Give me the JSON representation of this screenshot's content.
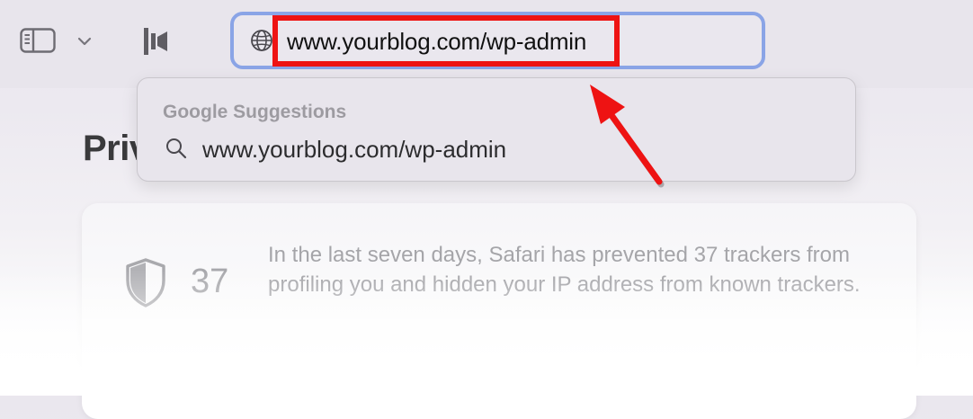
{
  "toolbar": {
    "sidebar_icon": "sidebar-icon",
    "chevron_icon": "chevron-down-icon",
    "extension_icon": "extension-logo-icon"
  },
  "address_bar": {
    "globe_icon": "globe-icon",
    "url": "www.yourblog.com/wp-admin",
    "focus_color": "#8aa4e6"
  },
  "annotation": {
    "highlight_color": "#ee1313",
    "arrow_icon": "red-arrow-icon"
  },
  "suggestions": {
    "header": "Google Suggestions",
    "items": [
      {
        "icon": "search-icon",
        "text": "www.yourblog.com/wp-admin"
      }
    ]
  },
  "page": {
    "heading": "Priv"
  },
  "privacy_report": {
    "shield_icon": "shield-icon",
    "count": "37",
    "description": "In the last seven days, Safari has prevented 37 trackers from profiling you and hidden your IP address from known trackers."
  }
}
